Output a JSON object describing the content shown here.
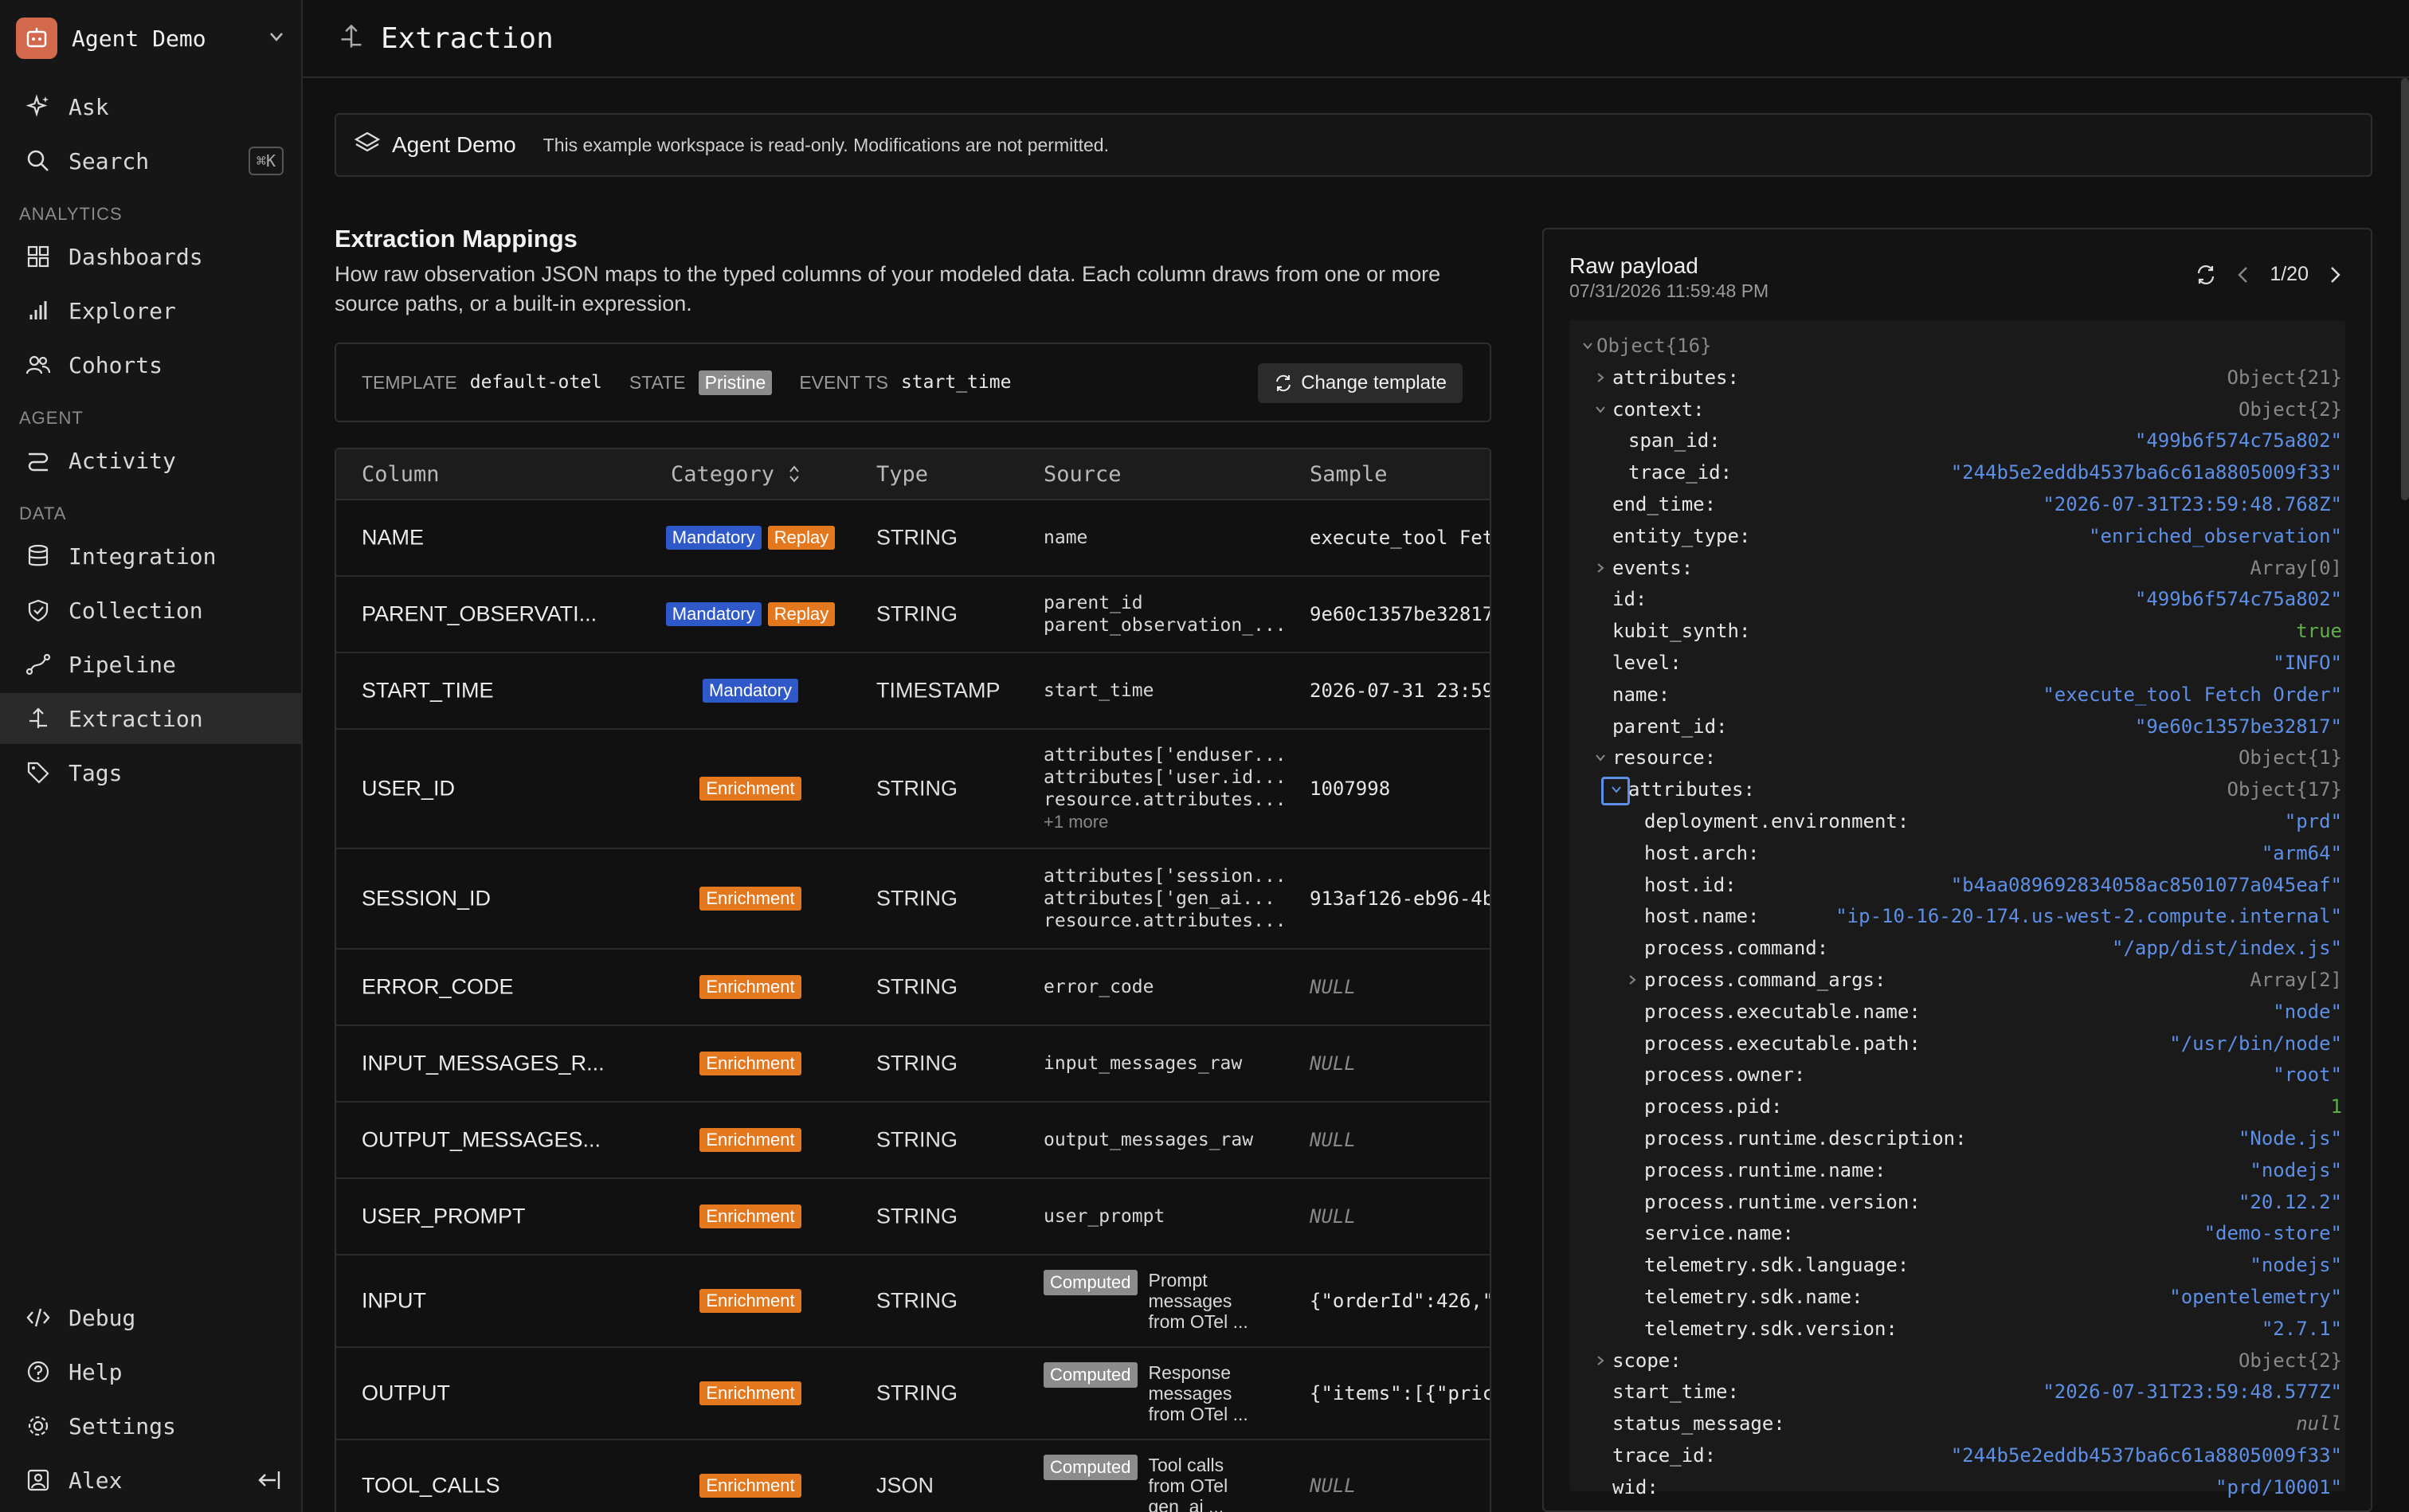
{
  "workspace": {
    "name": "Agent Demo"
  },
  "sidebar": {
    "top_items": [
      {
        "label": "Ask",
        "icon": "sparkle-icon"
      },
      {
        "label": "Search",
        "icon": "search-icon",
        "shortcut": "⌘K"
      }
    ],
    "sections": [
      {
        "label": "ANALYTICS",
        "items": [
          "Dashboards",
          "Explorer",
          "Cohorts"
        ]
      },
      {
        "label": "AGENT",
        "items": [
          "Activity"
        ]
      },
      {
        "label": "DATA",
        "items": [
          "Integration",
          "Collection",
          "Pipeline",
          "Extraction",
          "Tags"
        ]
      }
    ],
    "bottom_items": [
      "Debug",
      "Help",
      "Settings"
    ],
    "user": "Alex",
    "active": "Extraction"
  },
  "header": {
    "title": "Extraction"
  },
  "banner": {
    "name": "Agent Demo",
    "message": "This example workspace is read-only. Modifications are not permitted."
  },
  "mappings": {
    "title": "Extraction Mappings",
    "description": "How raw observation JSON maps to the typed columns of your modeled data. Each column draws from one or more source paths, or a built-in expression.",
    "template_label": "TEMPLATE",
    "template_value": "default-otel",
    "state_label": "STATE",
    "state_value": "Pristine",
    "event_ts_label": "EVENT TS",
    "event_ts_value": "start_time",
    "change_template": "Change template",
    "columns": [
      "Column",
      "Category",
      "Type",
      "Source",
      "Sample"
    ],
    "rows": [
      {
        "column": "NAME",
        "badges": [
          "Mandatory",
          "Replay"
        ],
        "type": "STRING",
        "source": [
          "name"
        ],
        "sample": "execute_tool Fet"
      },
      {
        "column": "PARENT_OBSERVATI...",
        "badges": [
          "Mandatory",
          "Replay"
        ],
        "type": "STRING",
        "source": [
          "parent_id",
          "parent_observation_..."
        ],
        "sample": "9e60c1357be32817"
      },
      {
        "column": "START_TIME",
        "badges": [
          "Mandatory"
        ],
        "type": "TIMESTAMP",
        "source": [
          "start_time"
        ],
        "sample": "2026-07-31 23:59"
      },
      {
        "column": "USER_ID",
        "badges": [
          "Enrichment"
        ],
        "type": "STRING",
        "source": [
          "attributes['enduser...",
          "attributes['user.id...",
          "resource.attributes..."
        ],
        "more": "+1 more",
        "sample": "1007998"
      },
      {
        "column": "SESSION_ID",
        "badges": [
          "Enrichment"
        ],
        "type": "STRING",
        "source": [
          "attributes['session...",
          "attributes['gen_ai...",
          "resource.attributes..."
        ],
        "sample": "913af126-eb96-4b"
      },
      {
        "column": "ERROR_CODE",
        "badges": [
          "Enrichment"
        ],
        "type": "STRING",
        "source": [
          "error_code"
        ],
        "sample": "NULL"
      },
      {
        "column": "INPUT_MESSAGES_R...",
        "badges": [
          "Enrichment"
        ],
        "type": "STRING",
        "source": [
          "input_messages_raw"
        ],
        "sample": "NULL"
      },
      {
        "column": "OUTPUT_MESSAGES...",
        "badges": [
          "Enrichment"
        ],
        "type": "STRING",
        "source": [
          "output_messages_raw"
        ],
        "sample": "NULL"
      },
      {
        "column": "USER_PROMPT",
        "badges": [
          "Enrichment"
        ],
        "type": "STRING",
        "source": [
          "user_prompt"
        ],
        "sample": "NULL"
      },
      {
        "column": "INPUT",
        "badges": [
          "Enrichment"
        ],
        "type": "STRING",
        "computed": true,
        "source": [
          "Prompt",
          "messages",
          "from OTel ..."
        ],
        "sample": "{\"orderId\":426,\""
      },
      {
        "column": "OUTPUT",
        "badges": [
          "Enrichment"
        ],
        "type": "STRING",
        "computed": true,
        "source": [
          "Response",
          "messages",
          "from OTel ..."
        ],
        "sample": "{\"items\":[{\"pric"
      },
      {
        "column": "TOOL_CALLS",
        "badges": [
          "Enrichment"
        ],
        "type": "JSON",
        "computed": true,
        "source": [
          "Tool calls",
          "from OTel",
          "gen_ai ..."
        ],
        "sample": "NULL"
      }
    ],
    "computed_label": "Computed"
  },
  "payload": {
    "title": "Raw payload",
    "timestamp": "07/31/2026 11:59:48 PM",
    "pager": "1/20",
    "lines": [
      {
        "indent": 0,
        "chev": "down",
        "key": "Object{16}",
        "value": "",
        "kind": "type",
        "keytype": true
      },
      {
        "indent": 1,
        "chev": "right",
        "key": "attributes:",
        "value": "Object{21}",
        "kind": "type"
      },
      {
        "indent": 1,
        "chev": "down",
        "key": "context:",
        "value": "Object{2}",
        "kind": "type"
      },
      {
        "indent": 2,
        "key": "span_id:",
        "value": "\"499b6f574c75a802\"",
        "kind": "str"
      },
      {
        "indent": 2,
        "key": "trace_id:",
        "value": "\"244b5e2eddb4537ba6c61a8805009f33\"",
        "kind": "str"
      },
      {
        "indent": 1,
        "key": "end_time:",
        "value": "\"2026-07-31T23:59:48.768Z\"",
        "kind": "str"
      },
      {
        "indent": 1,
        "key": "entity_type:",
        "value": "\"enriched_observation\"",
        "kind": "str"
      },
      {
        "indent": 1,
        "chev": "right",
        "key": "events:",
        "value": "Array[0]",
        "kind": "type"
      },
      {
        "indent": 1,
        "key": "id:",
        "value": "\"499b6f574c75a802\"",
        "kind": "str"
      },
      {
        "indent": 1,
        "key": "kubit_synth:",
        "value": "true",
        "kind": "bool"
      },
      {
        "indent": 1,
        "key": "level:",
        "value": "\"INFO\"",
        "kind": "str"
      },
      {
        "indent": 1,
        "key": "name:",
        "value": "\"execute_tool Fetch Order\"",
        "kind": "str"
      },
      {
        "indent": 1,
        "key": "parent_id:",
        "value": "\"9e60c1357be32817\"",
        "kind": "str"
      },
      {
        "indent": 1,
        "chev": "down",
        "key": "resource:",
        "value": "Object{1}",
        "kind": "type"
      },
      {
        "indent": 2,
        "chev": "down",
        "selected": true,
        "key": "attributes:",
        "value": "Object{17}",
        "kind": "type"
      },
      {
        "indent": 3,
        "key": "deployment.environment:",
        "value": "\"prd\"",
        "kind": "str"
      },
      {
        "indent": 3,
        "key": "host.arch:",
        "value": "\"arm64\"",
        "kind": "str"
      },
      {
        "indent": 3,
        "key": "host.id:",
        "value": "\"b4aa089692834058ac8501077a045eaf\"",
        "kind": "str"
      },
      {
        "indent": 3,
        "key": "host.name:",
        "value": "\"ip-10-16-20-174.us-west-2.compute.internal\"",
        "kind": "str"
      },
      {
        "indent": 3,
        "key": "process.command:",
        "value": "\"/app/dist/index.js\"",
        "kind": "str"
      },
      {
        "indent": 3,
        "chev": "right",
        "key": "process.command_args:",
        "value": "Array[2]",
        "kind": "type"
      },
      {
        "indent": 3,
        "key": "process.executable.name:",
        "value": "\"node\"",
        "kind": "str"
      },
      {
        "indent": 3,
        "key": "process.executable.path:",
        "value": "\"/usr/bin/node\"",
        "kind": "str"
      },
      {
        "indent": 3,
        "key": "process.owner:",
        "value": "\"root\"",
        "kind": "str"
      },
      {
        "indent": 3,
        "key": "process.pid:",
        "value": "1",
        "kind": "num"
      },
      {
        "indent": 3,
        "key": "process.runtime.description:",
        "value": "\"Node.js\"",
        "kind": "str"
      },
      {
        "indent": 3,
        "key": "process.runtime.name:",
        "value": "\"nodejs\"",
        "kind": "str"
      },
      {
        "indent": 3,
        "key": "process.runtime.version:",
        "value": "\"20.12.2\"",
        "kind": "str"
      },
      {
        "indent": 3,
        "key": "service.name:",
        "value": "\"demo-store\"",
        "kind": "str"
      },
      {
        "indent": 3,
        "key": "telemetry.sdk.language:",
        "value": "\"nodejs\"",
        "kind": "str"
      },
      {
        "indent": 3,
        "key": "telemetry.sdk.name:",
        "value": "\"opentelemetry\"",
        "kind": "str"
      },
      {
        "indent": 3,
        "key": "telemetry.sdk.version:",
        "value": "\"2.7.1\"",
        "kind": "str"
      },
      {
        "indent": 1,
        "chev": "right",
        "key": "scope:",
        "value": "Object{2}",
        "kind": "type"
      },
      {
        "indent": 1,
        "key": "start_time:",
        "value": "\"2026-07-31T23:59:48.577Z\"",
        "kind": "str"
      },
      {
        "indent": 1,
        "key": "status_message:",
        "value": "null",
        "kind": "nul"
      },
      {
        "indent": 1,
        "key": "trace_id:",
        "value": "\"244b5e2eddb4537ba6c61a8805009f33\"",
        "kind": "str"
      },
      {
        "indent": 1,
        "key": "wid:",
        "value": "\"prd/10001\"",
        "kind": "str"
      }
    ]
  },
  "colors": {
    "mandatory": "#2f59c8",
    "enrichment": "#e4781e",
    "computed": "#8c8c8c",
    "string_value": "#5e8fe6",
    "bool_value": "#5fae4a",
    "active_nav": "#2a2a2a"
  }
}
